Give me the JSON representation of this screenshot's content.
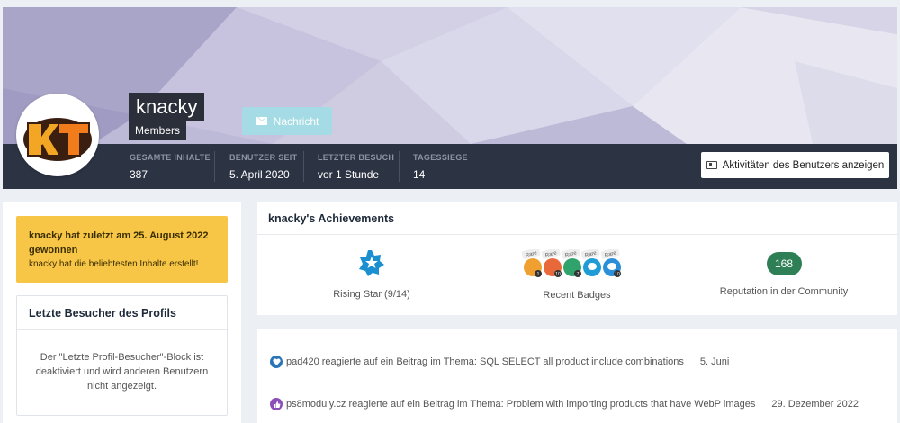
{
  "profile": {
    "username": "knacky",
    "group": "Members",
    "avatar_text": "KT",
    "message_button": "Nachricht",
    "activity_button": "Aktivitäten des Benutzers anzeigen"
  },
  "stats": [
    {
      "label": "GESAMTE INHALTE",
      "value": "387"
    },
    {
      "label": "BENUTZER SEIT",
      "value": "5. April 2020"
    },
    {
      "label": "LETZTER BESUCH",
      "value": "vor 1 Stunde"
    },
    {
      "label": "TAGESSIEGE",
      "value": "14"
    }
  ],
  "winner": {
    "title": "knacky hat zuletzt am 25. August 2022 gewonnen",
    "subtitle": "knacky hat die beliebtesten Inhalte erstellt!"
  },
  "visitors": {
    "title": "Letzte Besucher des Profils",
    "body": "Der \"Letzte Profil-Besucher\"-Block ist deaktiviert und wird anderen Benutzern nicht angezeigt."
  },
  "achievements": {
    "title": "knacky's Achievements",
    "rank_label": "Rising Star (9/14)",
    "badges_label": "Recent Badges",
    "badges": [
      {
        "tag": "Rare",
        "count": "1",
        "color": "#f0a030"
      },
      {
        "tag": "Rare",
        "count": "10",
        "color": "#e8683a"
      },
      {
        "tag": "Rare",
        "count": "7",
        "color": "#2fa36b"
      },
      {
        "tag": "Rare",
        "count": "",
        "color": "#1f9bd6"
      },
      {
        "tag": "Rare",
        "count": "10",
        "color": "#2a8fd8"
      }
    ],
    "reputation_value": "168",
    "reputation_label": "Reputation in der Community"
  },
  "feed": [
    {
      "user": "pad420",
      "text": "pad420 reagierte auf ein Beitrag im Thema: SQL SELECT all product include combinations",
      "date": "5. Juni",
      "icon": "heart-icon",
      "icon_color": "#2a74b8"
    },
    {
      "user": "ps8moduly.cz",
      "text": "ps8moduly.cz reagierte auf ein Beitrag im Thema: Problem with importing products that have WebP images",
      "date": "29. Dezember 2022",
      "icon": "thumbs-up-icon",
      "icon_color": "#8c4fb8"
    }
  ],
  "colors": {
    "statsbar": "#2c3343",
    "winner_bg": "#f8c646",
    "reputation": "#2f7f56",
    "message_button": "#a4dbe4"
  }
}
